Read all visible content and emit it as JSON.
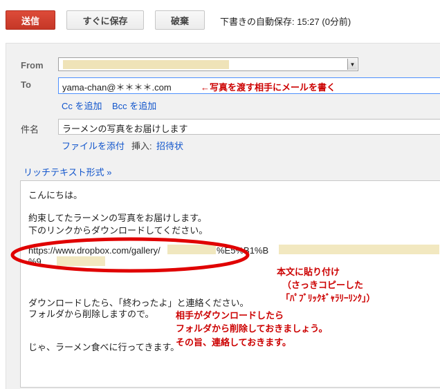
{
  "toolbar": {
    "send_label": "送信",
    "save_now_label": "すぐに保存",
    "discard_label": "破棄",
    "autosave_status": "下書きの自動保存: 15:27 (0分前)"
  },
  "fields": {
    "from_label": "From",
    "to_label": "To",
    "to_value": "yama-chan@＊＊＊＊.com",
    "cc_link": "Cc を追加",
    "bcc_link": "Bcc を追加",
    "subject_label": "件名",
    "subject_value": "ラーメンの写真をお届けします",
    "attach_link": "ファイルを添付",
    "insert_label": "挿入:",
    "invite_link": "招待状",
    "rich_text_link": "リッチテキスト形式 »"
  },
  "body": {
    "line1": "こんにちは。",
    "line2": "約束してたラーメンの写真をお届けします。",
    "line3": "下のリンクからダウンロードしてください。",
    "link_line1_start": "https://www.dropbox.com/gallery/",
    "link_line1_mid": "%E5%B1%B",
    "link_line2_start": "%9",
    "line6": "ダウンロードしたら、「終わったよ」と連絡ください。",
    "line7": "フォルダから削除しますので。",
    "line8": "じゃ、ラーメン食べに行ってきます。"
  },
  "annotations": {
    "to_note": "←写真を渡す相手にメールを書く",
    "paste_note_1": "本文に貼り付け",
    "paste_note_2": "（さっきコピーした",
    "paste_note_3": "「ﾊﾟﾌﾞﾘｯｸｷﾞｬﾗﾘｰﾘﾝｸ」）",
    "delete_note_1": "相手がダウンロードしたら",
    "delete_note_2": "フォルダから削除しておきましょう。",
    "delete_note_3": "その旨、連絡しておきます。"
  },
  "colors": {
    "send_button": "#dd4b39",
    "link": "#1155cc",
    "annotation": "#cc0000",
    "focus_border": "#4d90fe"
  }
}
